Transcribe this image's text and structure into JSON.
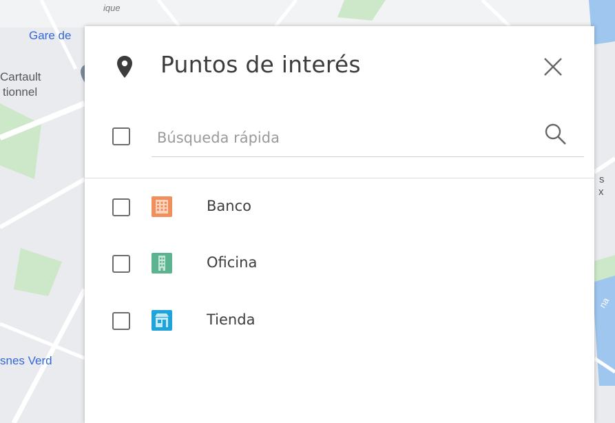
{
  "map": {
    "labels": [
      "Gare de",
      "Cartault",
      "tionnel",
      "snes Verd",
      "ique",
      "s",
      "x",
      "na"
    ]
  },
  "panel": {
    "title": "Puntos de interés",
    "header_icon": "location-pin-icon",
    "close_icon": "close-icon",
    "search": {
      "placeholder": "Búsqueda rápida",
      "value": "",
      "icon": "search-icon"
    },
    "items": [
      {
        "label": "Banco",
        "icon": "bank-icon",
        "color": "#f08f5c",
        "checked": false
      },
      {
        "label": "Oficina",
        "icon": "office-icon",
        "color": "#5bb38f",
        "checked": false
      },
      {
        "label": "Tienda",
        "icon": "shop-icon",
        "color": "#1fa4d9",
        "checked": false
      }
    ]
  }
}
